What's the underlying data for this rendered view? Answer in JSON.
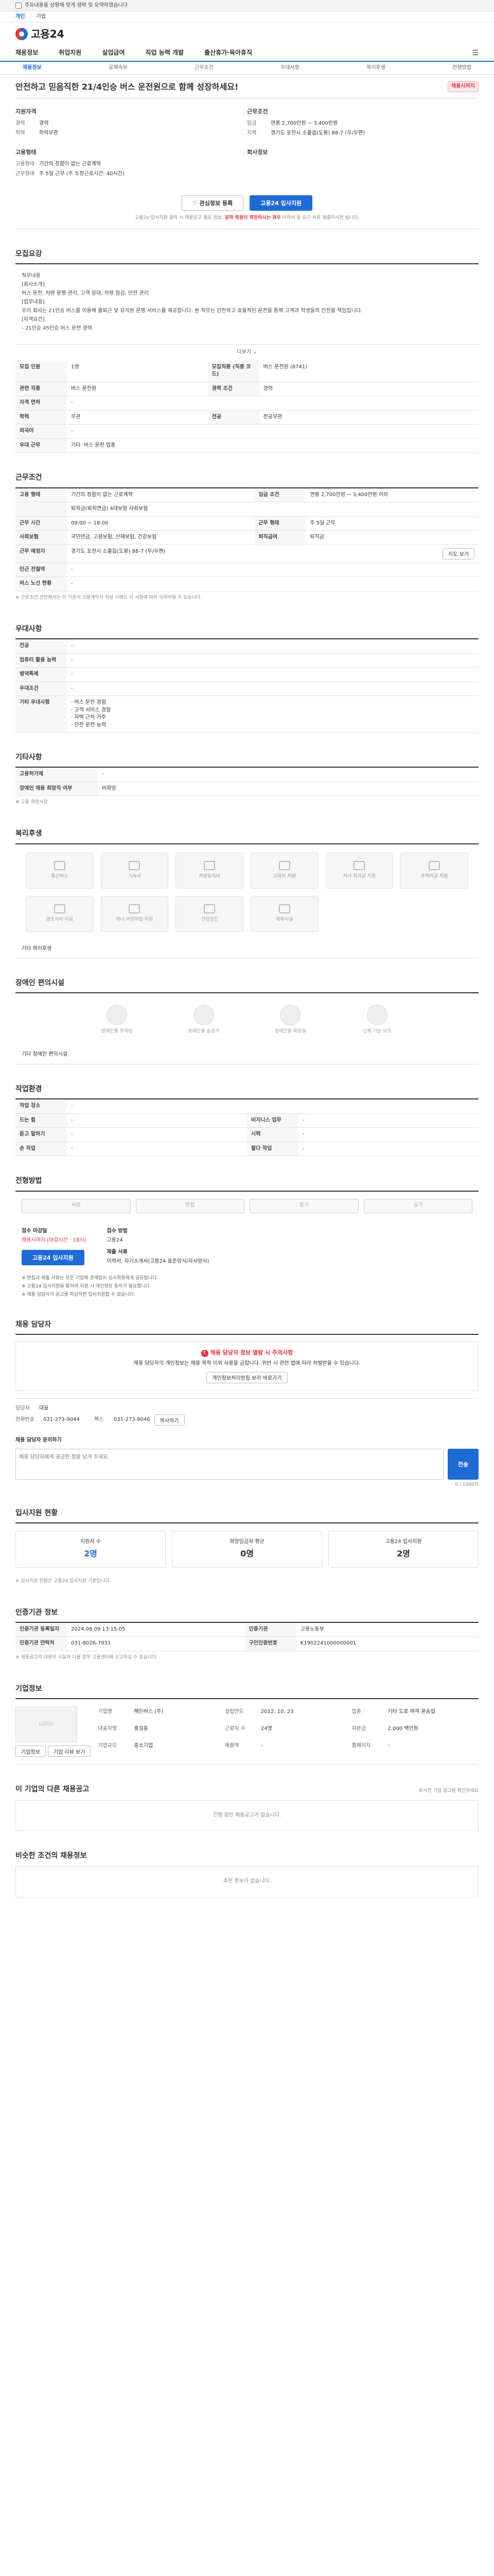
{
  "topstrip": {
    "text": "주요내용을 상황에 맞게 생략 및 요약하였습니다"
  },
  "toplinks": [
    "개인",
    "기업"
  ],
  "logo": {
    "text": "고용24"
  },
  "gnb": {
    "items": [
      "채용정보",
      "취업지원",
      "실업급여",
      "직업 능력 개발",
      "출산휴가·육아휴직"
    ],
    "menu_icon": "☰"
  },
  "subnav": [
    "채용정보",
    "공채속보",
    "근무조건",
    "우대사항",
    "복리후생",
    "전형방법"
  ],
  "job": {
    "title": "안전하고 믿음직한 21/4인승 버스 운전원으로 함께 성장하세요!",
    "badge": "채용시까지",
    "summary": {
      "col1": {
        "title": "지원자격",
        "rows": [
          [
            "경력",
            "경력"
          ],
          [
            "학력",
            "학력무관"
          ]
        ]
      },
      "col2": {
        "title": "근무조건",
        "rows": [
          [
            "임금",
            "연봉 2,700만원 ~ 3,400만원"
          ],
          [
            "지역",
            "경기도 포천시 소흘읍(도봉) 88-7 (우/우편)"
          ]
        ]
      },
      "col3": {
        "title": "고용형태",
        "rows": [
          [
            "고용형태",
            "기간의 정함이 없는 근로계약"
          ],
          [
            "근무형태",
            "주 5일 근무 (주 소정근로시간: 40시간)"
          ]
        ]
      },
      "col4": {
        "title": "회사정보",
        "rows": []
      }
    },
    "btn_scrap": "관심정보 등록",
    "btn_apply": "고용24 입사지원",
    "notice_a": "고용24 입사지원 클릭 시 채용공고 필요 정보, ",
    "notice_b": "공학 회원이 희망하시는 경우",
    "notice_c": " 이력서 등 요구 서류 제출하시면 됩니다."
  },
  "sections": {
    "recruit": "모집요강",
    "conditions": "근무조건",
    "prefer": "우대사항",
    "other": "기타사항",
    "welfare": "복리후생",
    "disabled": "장애인 편의시설",
    "env": "작업환경",
    "selection": "전형방법",
    "manager": "채용 담당자",
    "status": "입사지원 현황",
    "agency": "인증기관 정보",
    "company": "기업정보",
    "similar": "이 기업의 다른 채용공고",
    "nearby": "비슷한 조건의 채용정보"
  },
  "recruit": {
    "box": "직무내용\n[회사소개]\n버스 운전, 차량 운행 관리, 고객 응대, 차량 점검, 안전 관리\n[업무내용]\n우리 회사는 21인승 버스를 이용해 출퇴근 및 유치원 운행 서비스를 제공합니다. 본 직무는 안전하고 효율적인 운전을 통해 고객과 학생들의 안전을 책임집니다.\n[자격요건]\n- 21인승 45인승 버스 운전 경력",
    "more": "더보기",
    "rows": [
      [
        "모집 인원",
        "1명",
        "모집직종 (직종 코드)",
        "버스 운전원 (8741)"
      ],
      [
        "관련 직종",
        "버스 운전원",
        "경력 조건",
        "경력"
      ],
      [
        "자격 면허",
        "-",
        "",
        ""
      ],
      [
        "학력",
        "무관",
        "전공",
        "전공무관"
      ],
      [
        "외국어",
        "-",
        "",
        ""
      ],
      [
        "우대 근무",
        "기타",
        "",
        "버스 운전 업종"
      ]
    ]
  },
  "conditions": {
    "rows": [
      [
        "고용 형태",
        "기간의 정함이 없는 근로계약",
        "임금 조건",
        "연봉 2,700만원 ~ 3,400만원 이하"
      ],
      [
        "",
        "퇴직금(퇴직연금) 4대보험 사회보험",
        "",
        ""
      ],
      [
        "근무 시간",
        "09:00 ~ 18:00",
        "근무 형태",
        "주 5일 근무"
      ],
      [
        "사회보험",
        "국민연금, 고용보험, 산재보험, 건강보험",
        "퇴직급여",
        "퇴직금"
      ],
      [
        "근무 예정지",
        "경기도 포천시 소흘읍(도봉) 88-7 (우/우편)",
        "",
        "지도 보기"
      ],
      [
        "인근 전철역",
        "-",
        "",
        ""
      ],
      [
        "버스 노선 현황",
        "-",
        "",
        ""
      ]
    ],
    "note": "※ 근로조건 관련해서는 이 기준이 고용계약서 작성 시에도 이 사항에 따라 이루어질 수 있습니다."
  },
  "prefer": {
    "rows": [
      [
        "전공",
        "-"
      ],
      [
        "컴퓨터 활용 능력",
        "-"
      ],
      [
        "병역특례",
        "-"
      ],
      [
        "우대조건",
        "-"
      ],
      [
        "기타 우대사항",
        "· 버스 운전 경험\n· 고객 서비스 경험\n· 자택 근처 거주\n· 안전 운전 능력"
      ]
    ]
  },
  "other": {
    "rows": [
      [
        "고용허가제",
        "-"
      ],
      [
        "장애인 채용 희망직 여부",
        "비희망"
      ]
    ],
    "link": "고용 희망사항"
  },
  "welfare": {
    "items": [
      "통근버스",
      "기숙사",
      "차량유지비",
      "교육비 지원",
      "자녀 학자금 지원",
      "주택자금 지원",
      "경조사비 지급",
      "자녀 어린이집 지원",
      "건강검진",
      "체육시설"
    ],
    "line": "기타 복리후생"
  },
  "disabled": {
    "items": [
      "장애인용 주차장",
      "장애인용 승강기",
      "장애인용 화장실",
      "신체 기능 보조"
    ],
    "line": "기타 장애인 편의시설"
  },
  "env": {
    "rows": [
      [
        "작업 장소",
        "-",
        "",
        ""
      ],
      [
        "드는 힘",
        "-",
        "비지니스 업무",
        "-"
      ],
      [
        "듣고 말하기",
        "-",
        "시력",
        "-"
      ],
      [
        "손 작업",
        "-",
        "팔다 작업",
        "-"
      ]
    ]
  },
  "selection": {
    "methods": [
      "서류",
      "면접",
      "필기",
      "실기"
    ],
    "apply_way_label": "접수 마감일",
    "apply_way_value": "채용시까지 (마감시간 : 18시)",
    "apply_method_label": "접수 방법",
    "apply_method_value": "고용24",
    "docs_label": "제출 서류",
    "docs_value": "이력서, 자기소개서(고용24 표준양식/자사양식)",
    "apply_btn": "고용24 입사지원",
    "bullets": [
      "※ 면접과 제출 서류는 모든 기업에 관계없이 심사위원에게 공유됩니다.",
      "※ 고용24 입사지원을 통하여 지원 시 개인정보 동의가 필요합니다.",
      "※ 채용 담당자가 공고를 마감하면 입사지원할 수 없습니다."
    ]
  },
  "manager": {
    "warn_title": "채용 담당자 정보 열람 시 주의사항",
    "warn_body": "채용 담당자의 개인정보는 채용 목적 이외 사용을 금합니다. 위반 시 관련 법에 따라 처벌받을 수 있습니다.",
    "warn_btn": "개인정보처리방침 보러 바로가기",
    "name_label": "담당자",
    "name_value": "대표",
    "phone_label": "전화번호",
    "phone_value": "031-273-9044",
    "fax_label": "팩스",
    "fax_value": "031-273-9046",
    "copy_btn": "복사하기",
    "inq_title": "채용 담당자 문의하기",
    "inq_placeholder": "채용 담당자에게 궁금한 점을 남겨 주세요.",
    "inq_btn": "전송",
    "count": "0 / 1000자"
  },
  "status": {
    "items": [
      {
        "label": "지원자 수",
        "value": "2명"
      },
      {
        "label": "희망임금자 평균",
        "value": "0명"
      },
      {
        "label": "고용24 입사지원",
        "value": "2명"
      }
    ],
    "note": "※ 입사지원 현황은 고용24 입사지원 기준입니다."
  },
  "agency": {
    "rows": [
      [
        "인증기관 등록일자",
        "2024.08.09 13:15:05",
        "인증기관",
        "고용노동부"
      ],
      [
        "인증기관 연락처",
        "031-8026-7931",
        "구인인증번호",
        "K1902241000000001"
      ]
    ],
    "note": "※ 채용공고의 내용이 사실과 다를 경우 고용센터에 신고하실 수 있습니다."
  },
  "company": {
    "logo_alt": "LOGO",
    "rows": [
      [
        "기업명",
        "해든버스 (주)"
      ],
      [
        "설립연도",
        "2012. 10. 23"
      ],
      [
        "업종",
        "기타 도로 여객 운송업"
      ],
      [
        "대표자명",
        "홍길동"
      ],
      [
        "근로자 수",
        "24명"
      ],
      [
        "자본금",
        "2,000 백만원"
      ],
      [
        "기업규모",
        "중소기업"
      ],
      [
        "매출액",
        "-"
      ],
      [
        "홈페이지",
        "-"
      ]
    ],
    "btn1": "기업정보",
    "btn2": "기업 리뷰 보기"
  },
  "similar": {
    "empty": "진행 중인 채용공고가 없습니다.",
    "right": "유사한 기업 공고를 확인하세요"
  },
  "nearby": {
    "empty": "추천 정보가 없습니다."
  }
}
